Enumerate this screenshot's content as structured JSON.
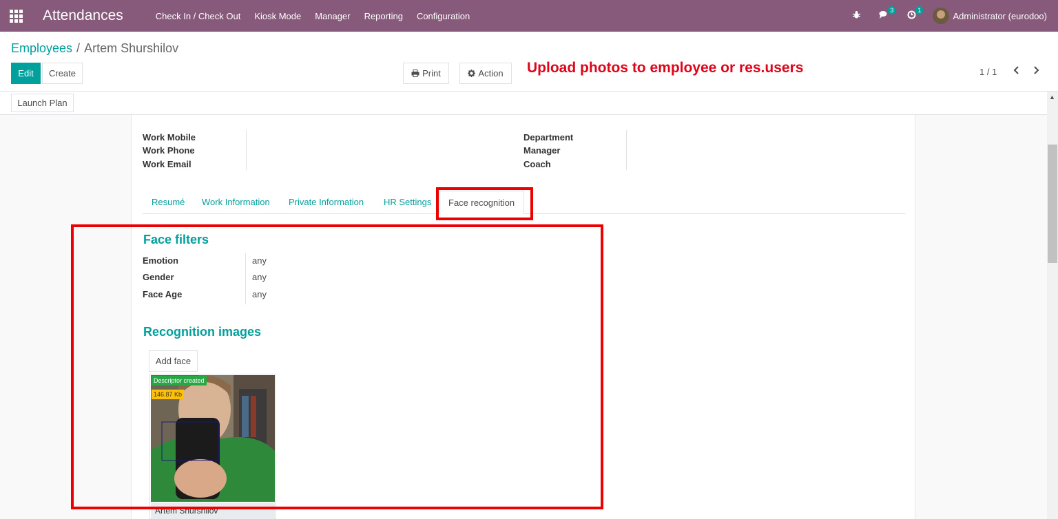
{
  "navbar": {
    "app_title": "Attendances",
    "menu": [
      "Check In / Check Out",
      "Kiosk Mode",
      "Manager",
      "Reporting",
      "Configuration"
    ],
    "messages_count": "3",
    "activities_count": "1",
    "user": "Administrator (eurodoo)"
  },
  "breadcrumb": {
    "parent": "Employees",
    "separator": "/",
    "current": "Artem Shurshilov"
  },
  "buttons": {
    "edit": "Edit",
    "create": "Create",
    "print": "Print",
    "action": "Action",
    "launch_plan": "Launch Plan"
  },
  "annotation": "Upload photos to employee or res.users",
  "pager": {
    "value": "1 / 1"
  },
  "fields_left": [
    "Work Mobile",
    "Work Phone",
    "Work Email"
  ],
  "fields_right": [
    "Department",
    "Manager",
    "Coach"
  ],
  "tabs": [
    "Resumé",
    "Work Information",
    "Private Information",
    "HR Settings",
    "Face recognition"
  ],
  "active_tab": "Face recognition",
  "face_filters": {
    "title": "Face filters",
    "rows": [
      {
        "label": "Emotion",
        "value": "any"
      },
      {
        "label": "Gender",
        "value": "any"
      },
      {
        "label": "Face Age",
        "value": "any"
      }
    ]
  },
  "recognition_images": {
    "title": "Recognition images",
    "add_button": "Add face",
    "card": {
      "status_tag": "Descriptor created",
      "size_tag": "146.87 Kb",
      "name": "Artem Shurshilov"
    }
  },
  "colors": {
    "brand": "#875a7b",
    "accent": "#00a09d",
    "highlight": "#ec0000"
  }
}
